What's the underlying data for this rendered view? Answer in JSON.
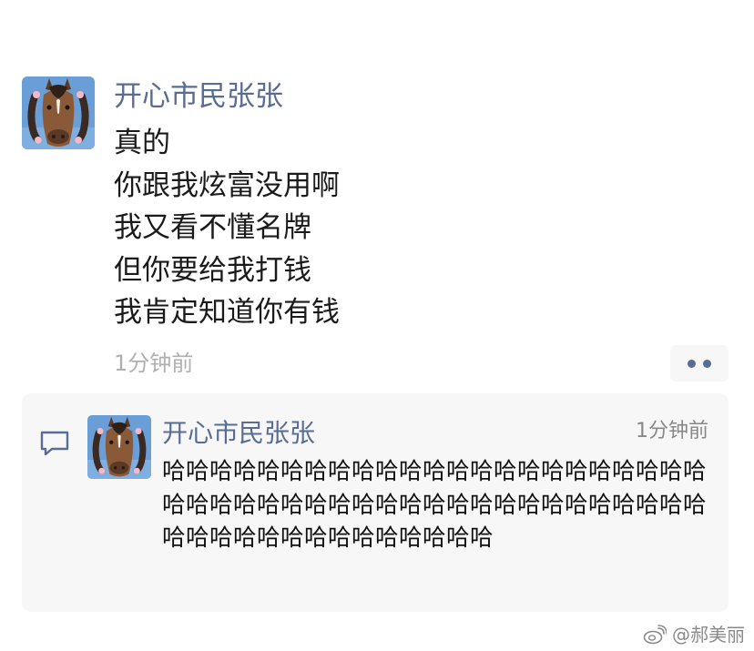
{
  "post": {
    "author": "开心市民张张",
    "avatar_icon": "horse-with-braids-avatar",
    "lines": [
      "真的",
      "你跟我炫富没用啊",
      "我又看不懂名牌",
      "但你要给我打钱",
      "我肯定知道你有钱"
    ],
    "time": "1分钟前",
    "more_icon": "more-dots-icon"
  },
  "comment": {
    "icon": "comment-bubble-icon",
    "author": "开心市民张张",
    "avatar_icon": "horse-with-braids-avatar",
    "time": "1分钟前",
    "text": "哈哈哈哈哈哈哈哈哈哈哈哈哈哈哈哈哈哈哈哈哈哈哈哈哈哈哈哈哈哈哈哈哈哈哈哈哈哈哈哈哈哈哈哈哈哈哈哈哈哈哈哈哈哈哈哈哈哈哈哈"
  },
  "watermark": {
    "icon": "weibo-icon",
    "text": "@郝美丽"
  },
  "colors": {
    "name_link": "#586c94",
    "panel_bg": "#f7f7f7",
    "muted_text": "#b0b0b0"
  }
}
